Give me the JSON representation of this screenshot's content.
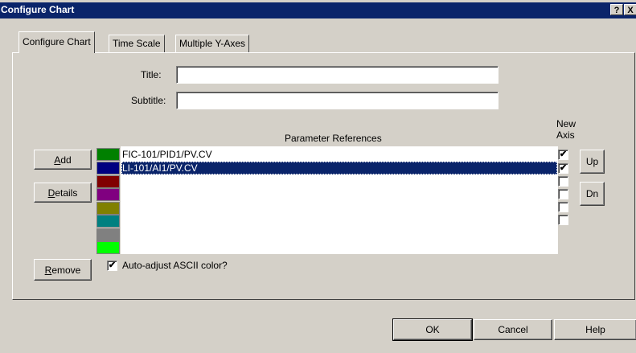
{
  "window": {
    "title": "Configure Chart",
    "help_glyph": "?",
    "close_glyph": "X"
  },
  "tabs": [
    {
      "label": "Configure Chart",
      "active": true
    },
    {
      "label": "Time Scale",
      "active": false
    },
    {
      "label": "Multiple Y-Axes",
      "active": false
    }
  ],
  "form": {
    "title_label": "Title:",
    "title_value": "",
    "subtitle_label": "Subtitle:",
    "subtitle_value": ""
  },
  "params": {
    "header": "Parameter References",
    "new_axis_header_1": "New",
    "new_axis_header_2": "Axis",
    "rows": [
      {
        "value": "FIC-101/PID1/PV.CV",
        "color": "#008000",
        "new_axis": true,
        "selected": false
      },
      {
        "value": "LI-101/AI1/PV.CV",
        "color": "#000080",
        "new_axis": true,
        "selected": true
      },
      {
        "value": "",
        "color": "#800000",
        "new_axis": false,
        "selected": false
      },
      {
        "value": "",
        "color": "#800080",
        "new_axis": false,
        "selected": false
      },
      {
        "value": "",
        "color": "#808000",
        "new_axis": false,
        "selected": false
      },
      {
        "value": "",
        "color": "#008080",
        "new_axis": false,
        "selected": false
      },
      {
        "value": "",
        "color": "#808080",
        "new_axis": null,
        "selected": false
      },
      {
        "value": "",
        "color": "#00ff00",
        "new_axis": null,
        "selected": false
      }
    ]
  },
  "buttons": {
    "add_accel": "A",
    "add_rest": "dd",
    "details_accel": "D",
    "details_rest": "etails",
    "remove_accel": "R",
    "remove_rest": "emove",
    "up": "Up",
    "dn": "Dn",
    "ok": "OK",
    "cancel": "Cancel",
    "help": "Help"
  },
  "auto_adjust": {
    "label": "Auto-adjust ASCII color?",
    "checked": true,
    "check_glyph": "✔"
  }
}
